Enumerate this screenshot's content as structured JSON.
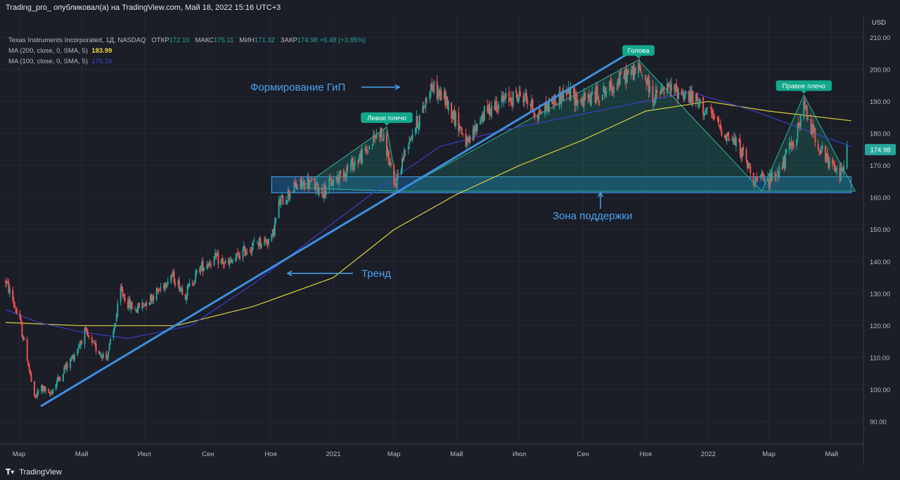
{
  "header": {
    "attribution": "Trading_pro_ опубликовал(а) на TradingView.com, Май 18, 2022 15:16 UTC+3"
  },
  "legend": {
    "symbol": "Texas Instruments Incorporated, 1Д, NASDAQ",
    "open_label": "ОТКР",
    "open_value": "172.10",
    "high_label": "МАКС",
    "high_value": "175.11",
    "low_label": "МИН",
    "low_value": "171.32",
    "close_label": "ЗАКР",
    "close_value": "174.98",
    "change": "+6.48 (+3.85%)",
    "ma200_label": "MA (200, close, 0, SMA, 5)",
    "ma200_value": "183.99",
    "ma100_label": "MA (100, close, 0, SMA, 5)",
    "ma100_value": "176.16"
  },
  "footer": {
    "brand": "TradingView"
  },
  "colors": {
    "background": "#1b1d27",
    "grid": "#262a36",
    "up": "#26a69a",
    "down": "#ef5350",
    "ma200": "#d9cf3f",
    "ma100": "#3a3fc4",
    "trend": "#3d8fe0",
    "zone": "#1e5f9a",
    "pattern": "#1b8a74"
  },
  "chart_data": {
    "type": "candlestick",
    "currency": "USD",
    "ylim": [
      83,
      216
    ],
    "y_ticks": [
      90,
      100,
      110,
      120,
      130,
      140,
      150,
      160,
      170,
      180,
      190,
      200,
      210
    ],
    "x_range": [
      "2020-02-17",
      "2022-06-01"
    ],
    "x_ticks": [
      {
        "date": "2020-03-01",
        "label": "Мар"
      },
      {
        "date": "2020-05-01",
        "label": "Май"
      },
      {
        "date": "2020-07-01",
        "label": "Июл"
      },
      {
        "date": "2020-09-01",
        "label": "Сен"
      },
      {
        "date": "2020-11-01",
        "label": "Ноя"
      },
      {
        "date": "2021-01-01",
        "label": "2021"
      },
      {
        "date": "2021-03-01",
        "label": "Мар"
      },
      {
        "date": "2021-05-01",
        "label": "Май"
      },
      {
        "date": "2021-07-01",
        "label": "Июл"
      },
      {
        "date": "2021-09-01",
        "label": "Сен"
      },
      {
        "date": "2021-11-01",
        "label": "Ноя"
      },
      {
        "date": "2022-01-01",
        "label": "2022"
      },
      {
        "date": "2022-03-01",
        "label": "Мар"
      },
      {
        "date": "2022-05-01",
        "label": "Май"
      }
    ],
    "last_price": 174.98,
    "last_price_label": "174.98",
    "close_path": [
      [
        "2020-02-17",
        134
      ],
      [
        "2020-02-24",
        128
      ],
      [
        "2020-03-02",
        121
      ],
      [
        "2020-03-09",
        110
      ],
      [
        "2020-03-16",
        97
      ],
      [
        "2020-03-23",
        101
      ],
      [
        "2020-03-30",
        98
      ],
      [
        "2020-04-06",
        102
      ],
      [
        "2020-04-13",
        106
      ],
      [
        "2020-04-20",
        109
      ],
      [
        "2020-04-27",
        113
      ],
      [
        "2020-05-04",
        118
      ],
      [
        "2020-05-11",
        114
      ],
      [
        "2020-05-18",
        112
      ],
      [
        "2020-05-25",
        110
      ],
      [
        "2020-06-01",
        118
      ],
      [
        "2020-06-08",
        131
      ],
      [
        "2020-06-15",
        127
      ],
      [
        "2020-06-22",
        125
      ],
      [
        "2020-07-01",
        127
      ],
      [
        "2020-07-15",
        131
      ],
      [
        "2020-07-27",
        136
      ],
      [
        "2020-08-10",
        130
      ],
      [
        "2020-08-24",
        138
      ],
      [
        "2020-09-07",
        141
      ],
      [
        "2020-09-21",
        139
      ],
      [
        "2020-10-05",
        143
      ],
      [
        "2020-10-19",
        146
      ],
      [
        "2020-11-02",
        147
      ],
      [
        "2020-11-09",
        158
      ],
      [
        "2020-11-23",
        163
      ],
      [
        "2020-12-07",
        165
      ],
      [
        "2020-12-21",
        162
      ],
      [
        "2021-01-04",
        166
      ],
      [
        "2021-01-18",
        170
      ],
      [
        "2021-02-01",
        174
      ],
      [
        "2021-02-15",
        181
      ],
      [
        "2021-02-22",
        175
      ],
      [
        "2021-03-01",
        163
      ],
      [
        "2021-03-15",
        178
      ],
      [
        "2021-03-29",
        187
      ],
      [
        "2021-04-05",
        195
      ],
      [
        "2021-04-19",
        191
      ],
      [
        "2021-05-03",
        183
      ],
      [
        "2021-05-12",
        176
      ],
      [
        "2021-05-24",
        185
      ],
      [
        "2021-06-07",
        189
      ],
      [
        "2021-06-21",
        191
      ],
      [
        "2021-07-05",
        192
      ],
      [
        "2021-07-19",
        186
      ],
      [
        "2021-08-02",
        190
      ],
      [
        "2021-08-16",
        193
      ],
      [
        "2021-08-30",
        190
      ],
      [
        "2021-09-13",
        192
      ],
      [
        "2021-09-27",
        194
      ],
      [
        "2021-10-11",
        198
      ],
      [
        "2021-10-25",
        200
      ],
      [
        "2021-11-01",
        197
      ],
      [
        "2021-11-08",
        191
      ],
      [
        "2021-11-22",
        194
      ],
      [
        "2021-12-06",
        193
      ],
      [
        "2021-12-20",
        190
      ],
      [
        "2022-01-03",
        186
      ],
      [
        "2022-01-17",
        180
      ],
      [
        "2022-01-31",
        176
      ],
      [
        "2022-02-14",
        166
      ],
      [
        "2022-02-28",
        165
      ],
      [
        "2022-03-14",
        170
      ],
      [
        "2022-03-28",
        180
      ],
      [
        "2022-04-04",
        188
      ],
      [
        "2022-04-11",
        182
      ],
      [
        "2022-04-25",
        172
      ],
      [
        "2022-05-09",
        167
      ],
      [
        "2022-05-16",
        175
      ]
    ],
    "ma200": [
      [
        "2020-02-17",
        121
      ],
      [
        "2020-05-01",
        120
      ],
      [
        "2020-08-01",
        120
      ],
      [
        "2020-10-15",
        126
      ],
      [
        "2021-01-01",
        135
      ],
      [
        "2021-03-01",
        150
      ],
      [
        "2021-05-01",
        161
      ],
      [
        "2021-07-01",
        170
      ],
      [
        "2021-09-01",
        178
      ],
      [
        "2021-11-01",
        187
      ],
      [
        "2022-01-01",
        190
      ],
      [
        "2022-03-01",
        187
      ],
      [
        "2022-05-20",
        184
      ]
    ],
    "ma100": [
      [
        "2020-02-17",
        125
      ],
      [
        "2020-03-20",
        121
      ],
      [
        "2020-05-01",
        118
      ],
      [
        "2020-06-15",
        116
      ],
      [
        "2020-08-15",
        120
      ],
      [
        "2020-10-15",
        133
      ],
      [
        "2020-12-15",
        148
      ],
      [
        "2021-02-15",
        163
      ],
      [
        "2021-04-15",
        176
      ],
      [
        "2021-06-15",
        181
      ],
      [
        "2021-08-15",
        185
      ],
      [
        "2021-10-15",
        189
      ],
      [
        "2021-12-15",
        193
      ],
      [
        "2022-02-15",
        187
      ],
      [
        "2022-04-15",
        180
      ],
      [
        "2022-05-20",
        176
      ]
    ],
    "support_zone": {
      "low": 161.5,
      "high": 166.5,
      "start": "2020-11-02",
      "end": "2022-05-20"
    },
    "trend_line": [
      [
        "2020-03-23",
        95
      ],
      [
        "2021-10-15",
        205
      ]
    ],
    "pattern_points": [
      [
        "2020-11-30",
        163
      ],
      [
        "2021-02-22",
        182
      ],
      [
        "2021-03-05",
        162
      ],
      [
        "2021-10-25",
        203
      ],
      [
        "2022-02-22",
        162
      ],
      [
        "2022-04-04",
        192
      ],
      [
        "2022-05-24",
        162
      ]
    ],
    "annotations": {
      "left_shoulder": {
        "text": "Левое плечо",
        "date": "2021-02-22",
        "value": 182
      },
      "head": {
        "text": "Голова",
        "date": "2021-10-25",
        "value": 203
      },
      "right_shoulder": {
        "text": "Правое плечо",
        "date": "2022-04-04",
        "value": 192
      },
      "pattern_label": {
        "text": "Формирование ГиП"
      },
      "trend_label": {
        "text": "Тренд"
      },
      "support_label": {
        "text": "Зона поддержки"
      }
    }
  }
}
